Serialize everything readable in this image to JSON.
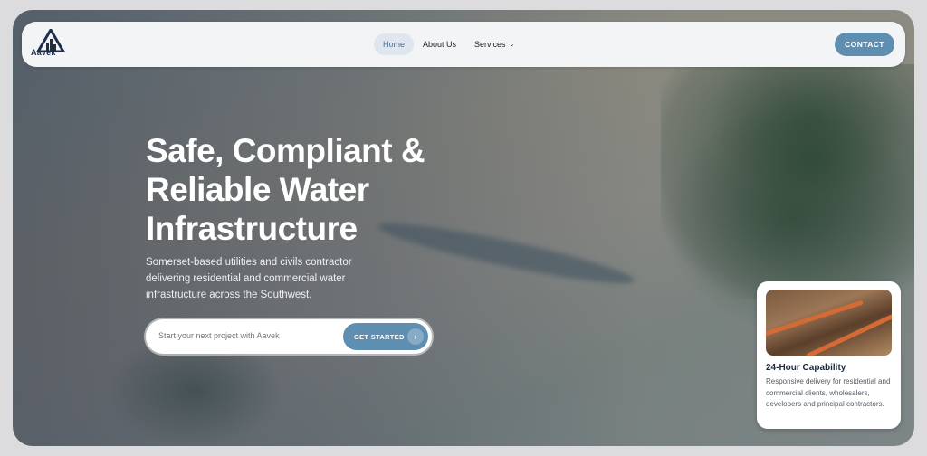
{
  "brand": {
    "name": "Aavek"
  },
  "nav": {
    "items": [
      {
        "label": "Home"
      },
      {
        "label": "About Us"
      },
      {
        "label": "Services"
      }
    ],
    "contact_label": "CONTACT"
  },
  "hero": {
    "title": "Safe, Compliant & Reliable Water Infrastructure",
    "subtitle": "Somerset-based utilities and civils contractor delivering residential and commercial water infrastructure across the Southwest.",
    "cta_placeholder": "Start your next project with Aavek",
    "cta_button": "GET STARTED"
  },
  "card": {
    "title": "24-Hour Capability",
    "text": "Responsive delivery for residential and commercial clients, wholesalers, developers and principal contractors."
  },
  "colors": {
    "accent": "#5f8fb0",
    "navbar": "#f3f4f6",
    "brand_dark": "#1e2f4a"
  }
}
